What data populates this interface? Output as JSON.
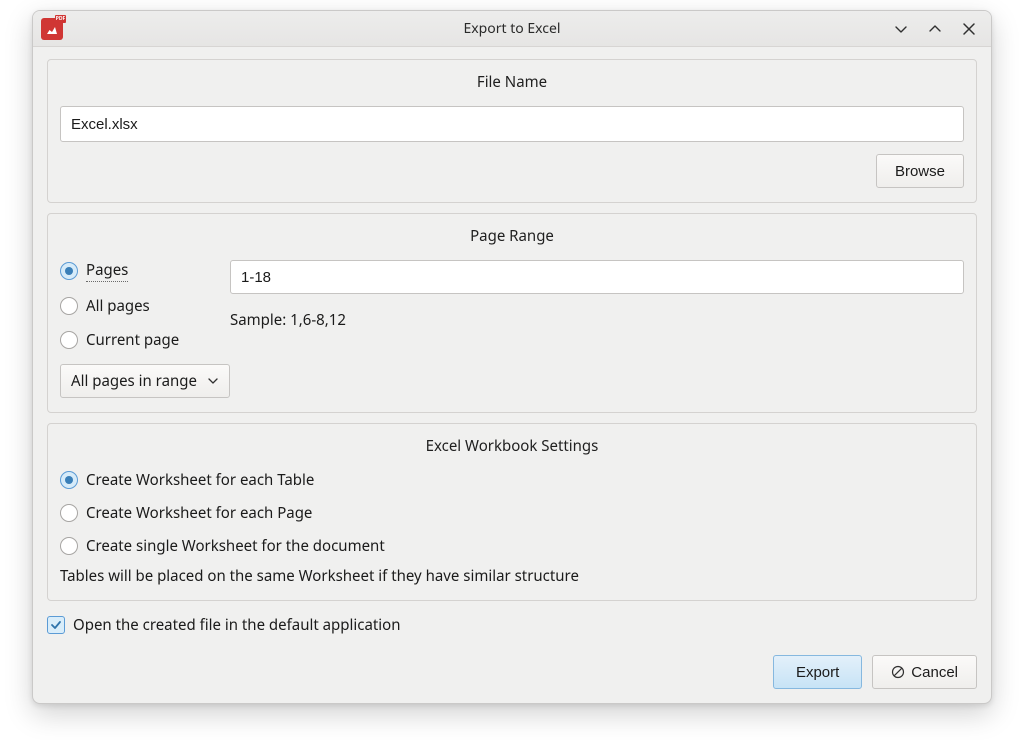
{
  "window": {
    "title": "Export to Excel"
  },
  "groups": {
    "filename": {
      "title": "File Name",
      "value": "Excel.xlsx",
      "browse_label": "Browse"
    },
    "page_range": {
      "title": "Page Range",
      "options": {
        "pages": "Pages",
        "all": "All pages",
        "current": "Current page"
      },
      "range_value": "1-18",
      "sample_text": "Sample: 1,6-8,12",
      "subset_selected": "All pages in range"
    },
    "workbook": {
      "title": "Excel Workbook Settings",
      "options": {
        "per_table": "Create Worksheet for each Table",
        "per_page": "Create Worksheet for each Page",
        "single": "Create single Worksheet for the document"
      },
      "note": "Tables will be placed on the same Worksheet if they have similar structure"
    }
  },
  "open_after": {
    "label": "Open the created file in the default application",
    "checked": true
  },
  "footer": {
    "export_label": "Export",
    "cancel_label": "Cancel"
  }
}
